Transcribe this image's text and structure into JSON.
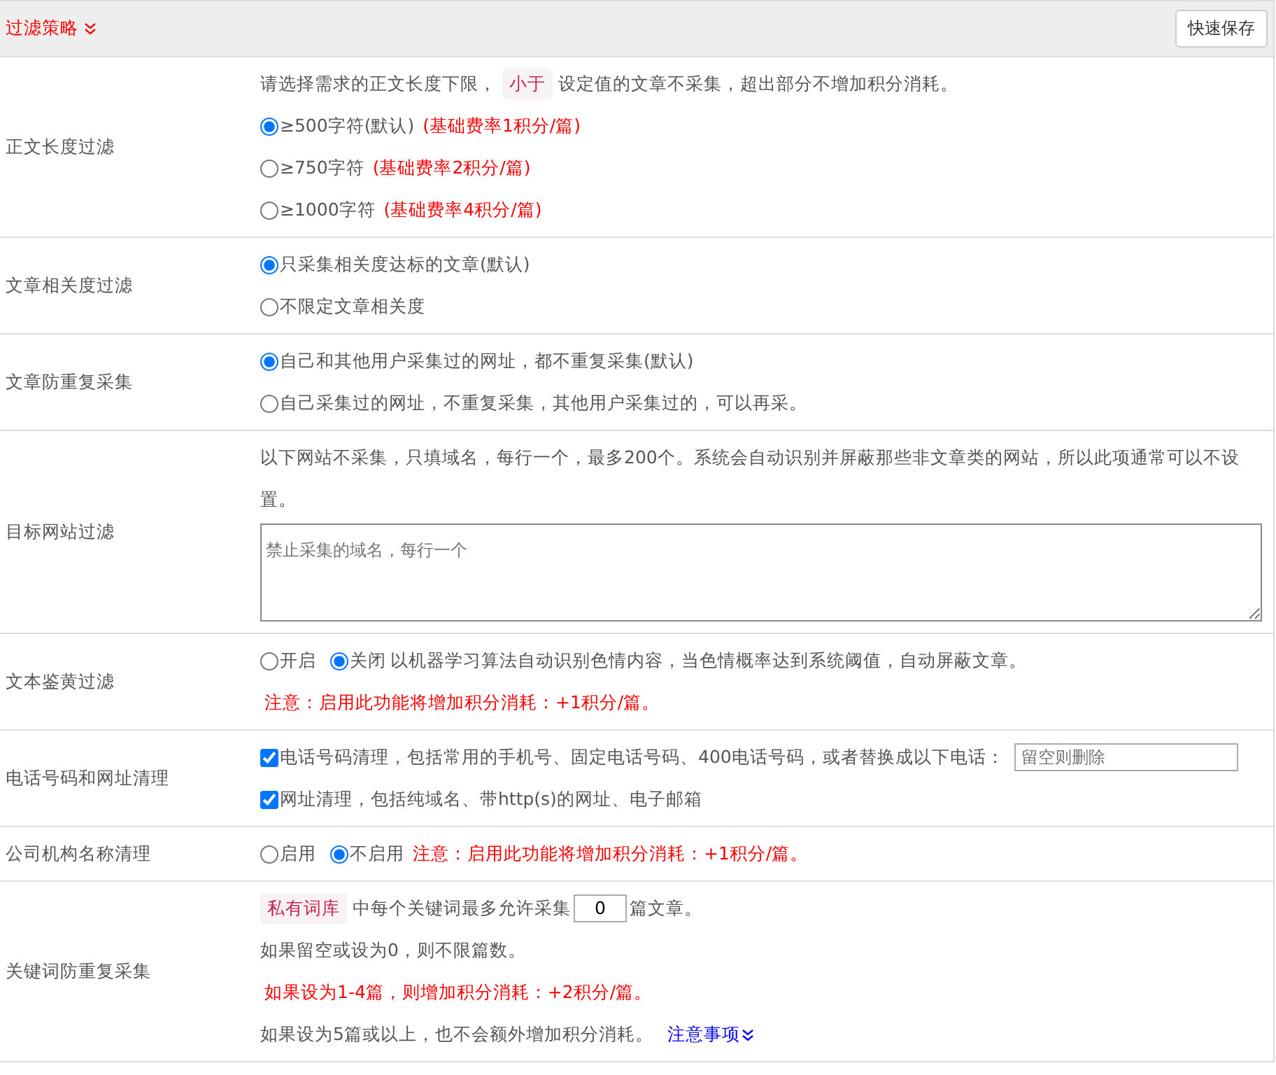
{
  "header": {
    "title": "过滤策略",
    "save_button": "快速保存"
  },
  "sections": [
    {
      "label": "正文长度过滤",
      "lines": [
        [
          {
            "kind": "text",
            "text": "请选择需求的正文长度下限，"
          },
          {
            "kind": "tag",
            "text": "小于"
          },
          {
            "kind": "text",
            "text": "设定值的文章不采集，超出部分不增加积分消耗。"
          }
        ],
        [
          {
            "kind": "radio",
            "label": "≥500字符(默认)",
            "selected": true
          },
          {
            "kind": "red",
            "text": "(基础费率1积分/篇)"
          }
        ],
        [
          {
            "kind": "radio",
            "label": "≥750字符",
            "selected": false
          },
          {
            "kind": "red",
            "text": "(基础费率2积分/篇)"
          }
        ],
        [
          {
            "kind": "radio",
            "label": "≥1000字符",
            "selected": false
          },
          {
            "kind": "red",
            "text": "(基础费率4积分/篇)"
          }
        ]
      ]
    },
    {
      "label": "文章相关度过滤",
      "lines": [
        [
          {
            "kind": "radio",
            "label": "只采集相关度达标的文章(默认)",
            "selected": true
          }
        ],
        [
          {
            "kind": "radio",
            "label": "不限定文章相关度",
            "selected": false
          }
        ]
      ]
    },
    {
      "label": "文章防重复采集",
      "lines": [
        [
          {
            "kind": "radio",
            "label": "自己和其他用户采集过的网址，都不重复采集(默认)",
            "selected": true
          }
        ],
        [
          {
            "kind": "radio",
            "label": "自己采集过的网址，不重复采集，其他用户采集过的，可以再采。",
            "selected": false
          }
        ]
      ]
    },
    {
      "label": "目标网站过滤",
      "lines": [
        [
          {
            "kind": "text",
            "text": "以下网站不采集，只填域名，每行一个，最多200个。系统会自动识别并屏蔽那些非文章类的网站，所以此项通常可以不设置。"
          }
        ],
        [
          {
            "kind": "textarea",
            "placeholder": "禁止采集的域名，每行一个"
          }
        ]
      ]
    },
    {
      "label": "文本鉴黄过滤",
      "lines": [
        [
          {
            "kind": "radio",
            "label": "开启",
            "selected": false
          },
          {
            "kind": "radio",
            "label": "关闭",
            "selected": true
          },
          {
            "kind": "text",
            "text": "以机器学习算法自动识别色情内容，当色情概率达到系统阈值，自动屏蔽文章。"
          }
        ],
        [
          {
            "kind": "red",
            "text": "注意：启用此功能将增加积分消耗：+1积分/篇。"
          }
        ]
      ]
    },
    {
      "label": "电话号码和网址清理",
      "lines": [
        [
          {
            "kind": "checkbox",
            "label": "电话号码清理，包括常用的手机号、固定电话号码、400电话号码，或者替换成以下电话：",
            "checked": true
          },
          {
            "kind": "field",
            "placeholder": "留空则删除"
          }
        ],
        [
          {
            "kind": "checkbox",
            "label": "网址清理，包括纯域名、带http(s)的网址、电子邮箱",
            "checked": true
          }
        ]
      ]
    },
    {
      "label": "公司机构名称清理",
      "lines": [
        [
          {
            "kind": "radio",
            "label": "启用",
            "selected": false
          },
          {
            "kind": "radio",
            "label": "不启用",
            "selected": true
          },
          {
            "kind": "red",
            "text": "注意：启用此功能将增加积分消耗：+1积分/篇。"
          }
        ]
      ]
    },
    {
      "label": "关键词防重复采集",
      "lines": [
        [
          {
            "kind": "tag",
            "text": "私有词库"
          },
          {
            "kind": "text",
            "text": "中每个关键词最多允许采集"
          },
          {
            "kind": "number",
            "value": "0"
          },
          {
            "kind": "text",
            "text": "篇文章。"
          }
        ],
        [
          {
            "kind": "text",
            "text": "如果留空或设为0，则不限篇数。"
          }
        ],
        [
          {
            "kind": "red",
            "text": "如果设为1-4篇，则增加积分消耗：+2积分/篇。"
          }
        ],
        [
          {
            "kind": "text",
            "text": "如果设为5篇或以上，也不会额外增加积分消耗。"
          },
          {
            "kind": "link",
            "text": "注意事项"
          }
        ]
      ]
    }
  ]
}
